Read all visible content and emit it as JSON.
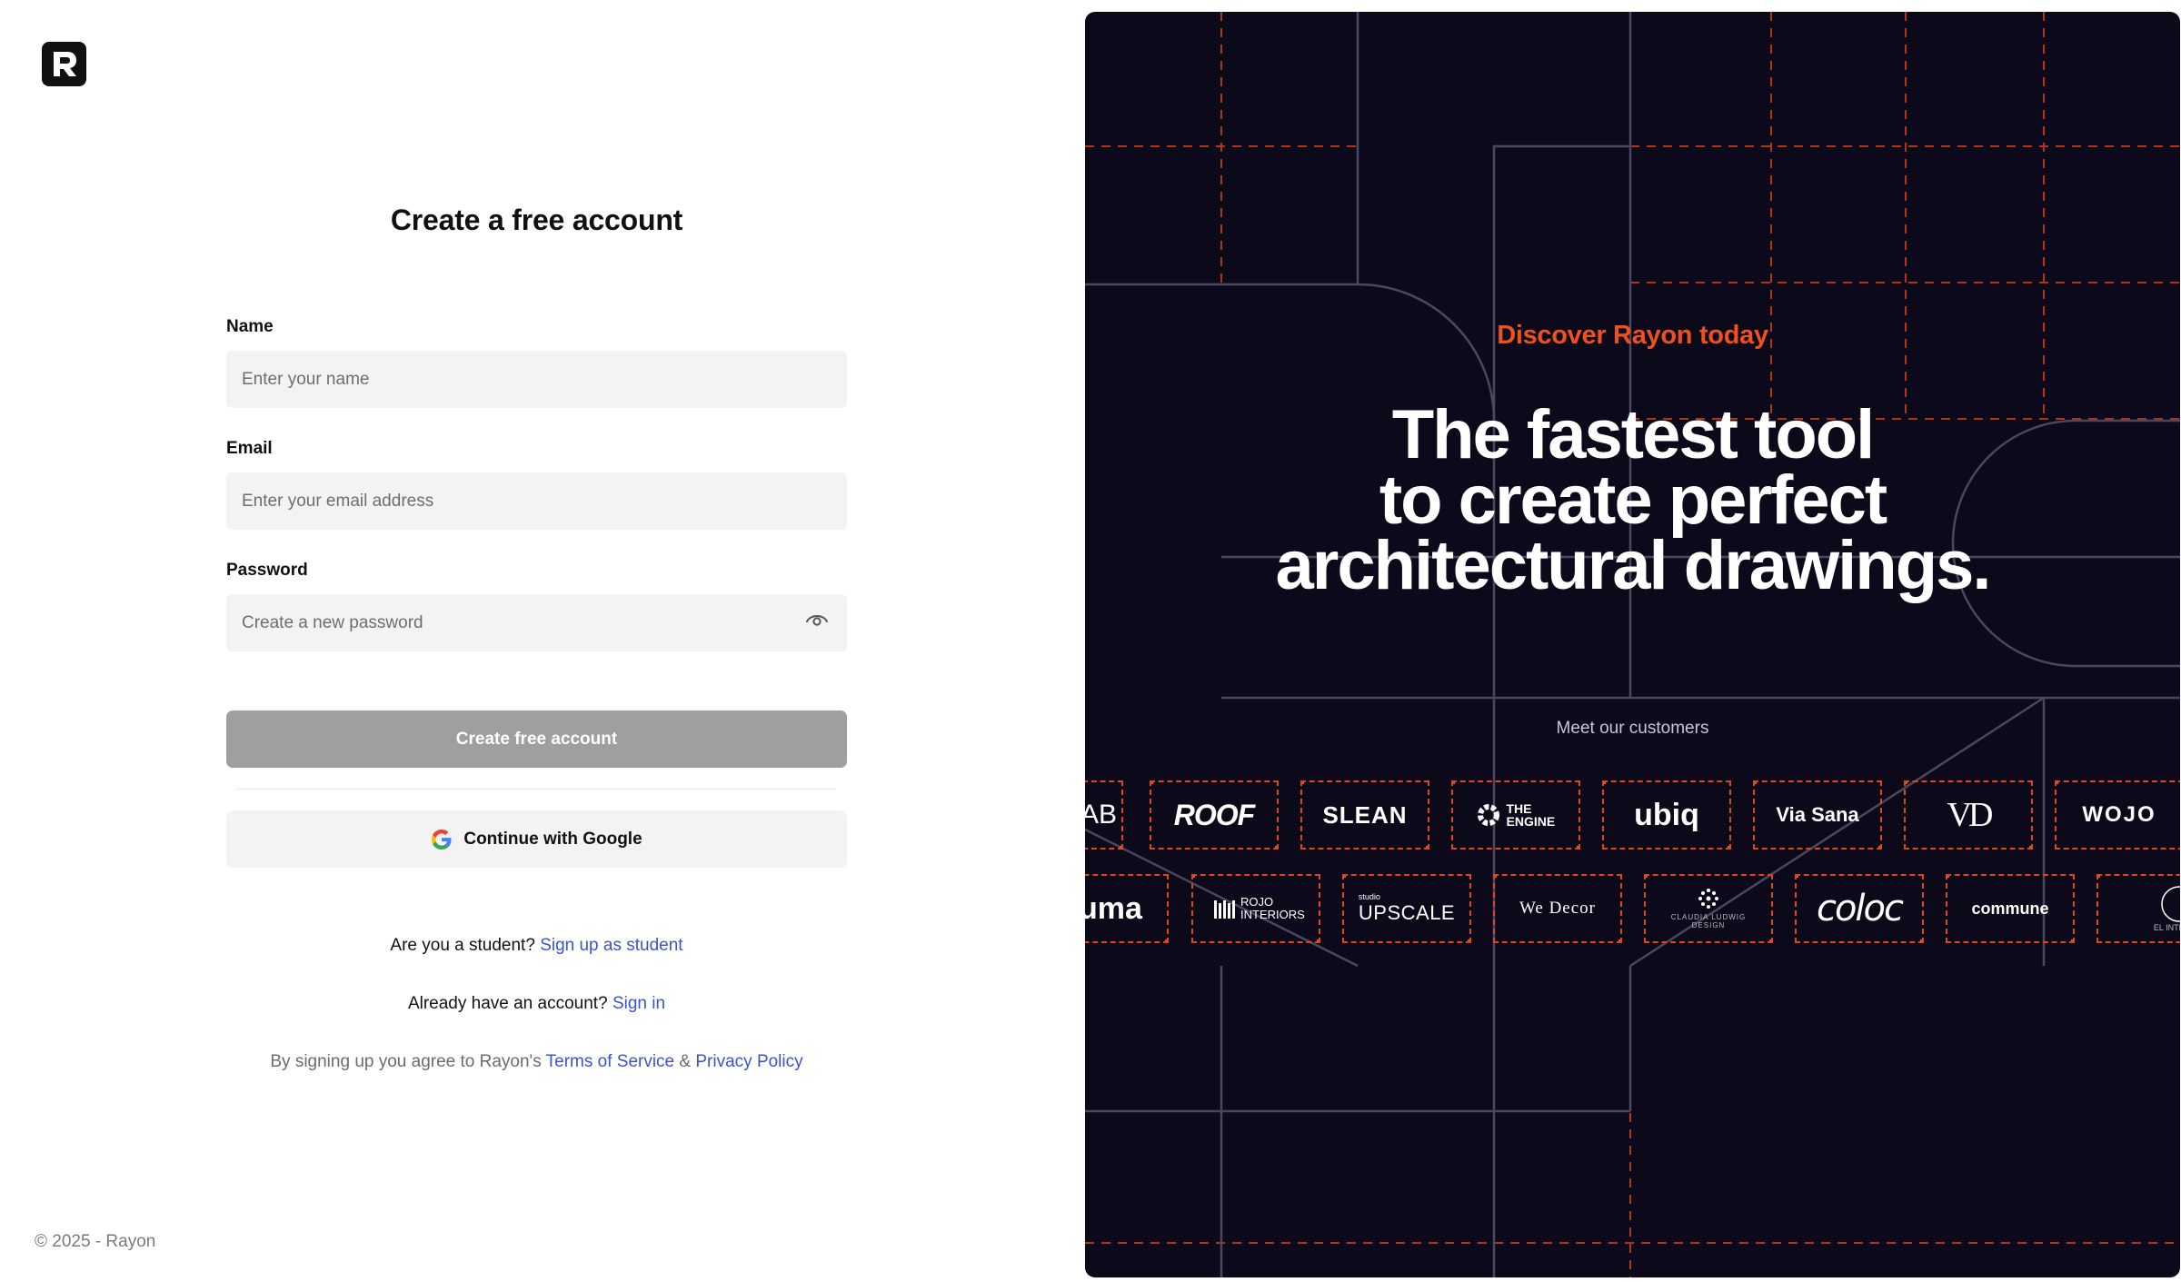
{
  "brand": {
    "name": "Rayon"
  },
  "form": {
    "title": "Create a free account",
    "name_label": "Name",
    "name_placeholder": "Enter your name",
    "email_label": "Email",
    "email_placeholder": "Enter your email address",
    "password_label": "Password",
    "password_placeholder": "Create a new password",
    "submit_label": "Create free account",
    "google_label": "Continue with Google"
  },
  "links": {
    "student_prompt": "Are you a student?",
    "student_link": "Sign up as student",
    "signin_prompt": "Already have an account?",
    "signin_link": "Sign in",
    "legal_prefix": "By signing up you agree to Rayon's",
    "terms_link": "Terms of Service",
    "legal_and": "&",
    "privacy_link": "Privacy Policy"
  },
  "footer": {
    "copyright": "© 2025 - Rayon"
  },
  "hero": {
    "eyebrow": "Discover Rayon today",
    "headline_lines": [
      "The fastest tool",
      "to create perfect",
      "architectural drawings."
    ],
    "customers_label": "Meet our customers",
    "accent_color": "#f0501e",
    "background_color": "#0c0a1a",
    "row1": [
      "AB",
      "ROOF",
      "SLEAN",
      "THE ENGINE",
      "ubiq",
      "Via Sana",
      "VD",
      "WOJO"
    ],
    "row2": [
      "uma",
      "ROJO INTERIORS",
      "UPSCALE",
      "We Decor",
      "CLAUDIA LUDWIG DESIGN",
      "coloc",
      "commune",
      "EL INTERIOR"
    ],
    "row2_small": {
      "upscale_prefix": "studio"
    }
  },
  "icons": {
    "password_toggle": "eye-icon",
    "google": "google-g-icon",
    "logo": "rayon-logo-icon"
  }
}
